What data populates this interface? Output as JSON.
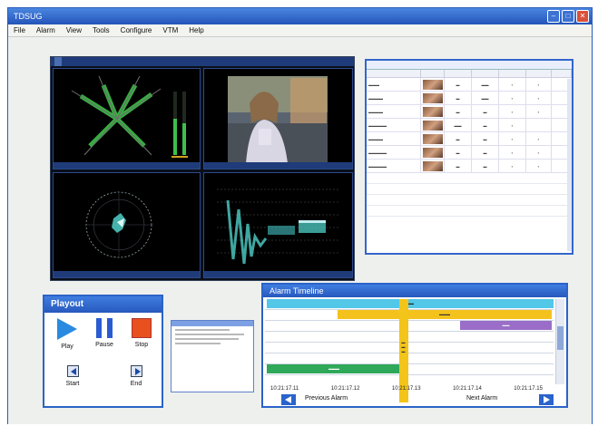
{
  "window": {
    "title": "TDSUG"
  },
  "menu": [
    "File",
    "Alarm",
    "View",
    "Tools",
    "Configure",
    "VTM",
    "Help"
  ],
  "playout": {
    "title": "Playout",
    "play_label": "Play",
    "pause_label": "Pause",
    "stop_label": "Stop",
    "start_label": "Start",
    "end_label": "End"
  },
  "timeline": {
    "title": "Alarm Timeline",
    "ticks": [
      "10:21:17.11",
      "10:21:17.12",
      "10:21:17.13",
      "10:21:17.14",
      "10:21:17.15"
    ],
    "previous_label": "Previous Alarm",
    "next_label": "Next Alarm"
  },
  "colors": {
    "titlebar": "#2454b8",
    "panel_border": "#2b63c8",
    "play": "#2a8ae0",
    "stop": "#e8501e",
    "marker": "#f3c419",
    "bar_cyan": "#52c7e8",
    "bar_yellow": "#f4c21c",
    "bar_purple": "#9a6ec8",
    "bar_green": "#2fa85a"
  },
  "icons": [
    "play-icon",
    "pause-icon",
    "stop-icon",
    "start-icon",
    "end-icon",
    "previous-alarm-icon",
    "next-alarm-icon",
    "minimize-icon",
    "maximize-icon",
    "close-icon"
  ]
}
